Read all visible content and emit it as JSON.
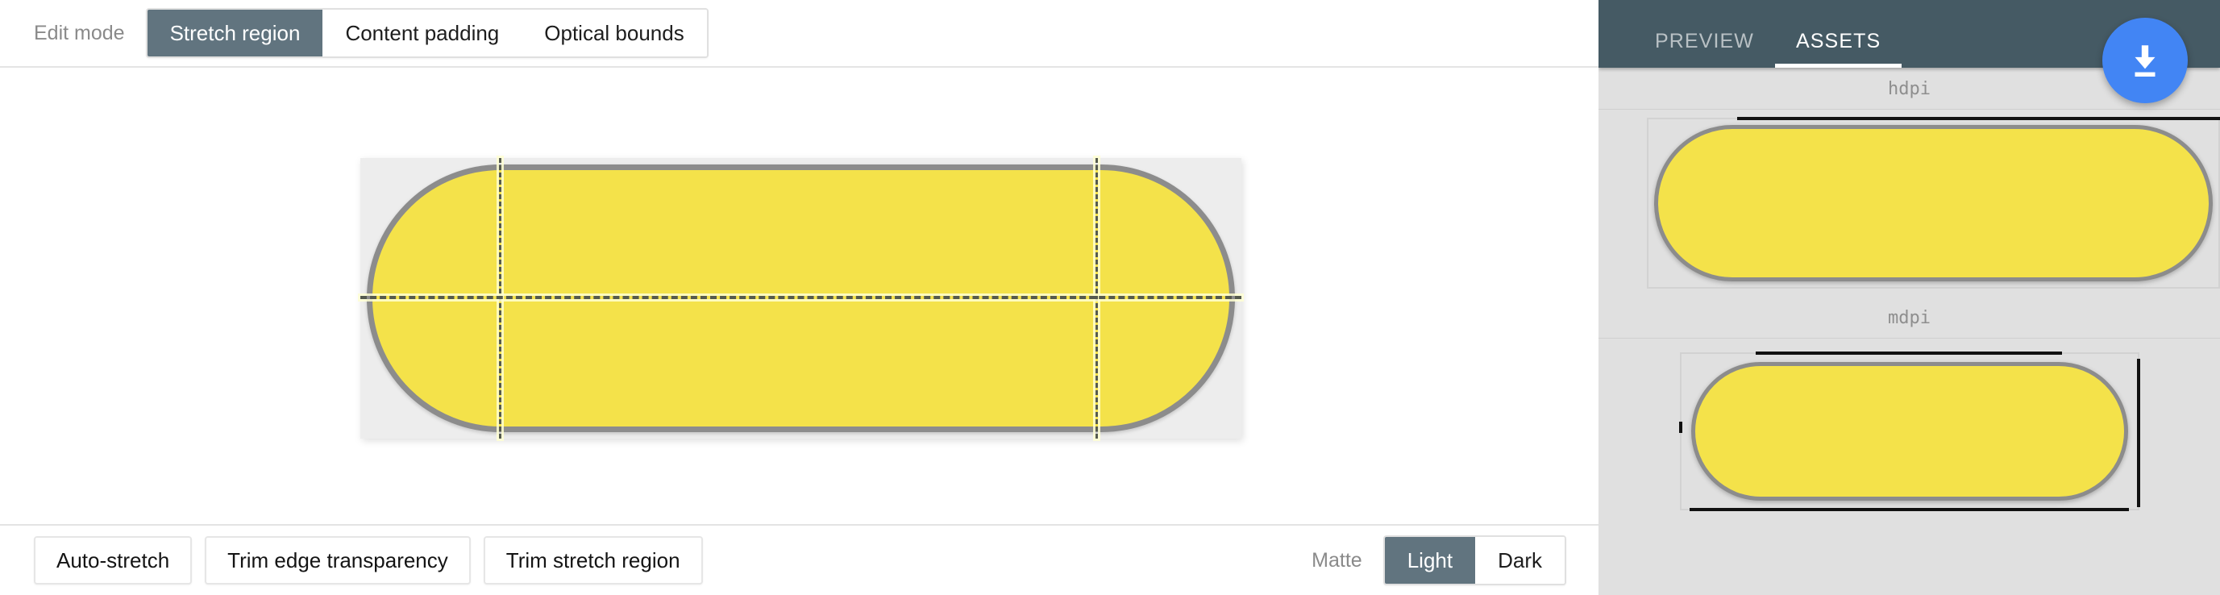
{
  "editor": {
    "top_toolbar": {
      "label": "Edit mode",
      "modes": [
        {
          "label": "Stretch region",
          "active": true
        },
        {
          "label": "Content padding",
          "active": false
        },
        {
          "label": "Optical bounds",
          "active": false
        }
      ]
    },
    "canvas": {
      "shape_fill": "#F4E24A",
      "shape_stroke": "#8C8C8C",
      "card_background": "#EDEDED",
      "guide_color": "#555A4E",
      "guides": [
        "stretch-left",
        "stretch-right",
        "stretch-horizontal"
      ]
    },
    "bottom_toolbar": {
      "actions": [
        {
          "label": "Auto-stretch"
        },
        {
          "label": "Trim edge transparency"
        },
        {
          "label": "Trim stretch region"
        }
      ],
      "matte_label": "Matte",
      "matte_options": [
        {
          "label": "Light",
          "active": true
        },
        {
          "label": "Dark",
          "active": false
        }
      ]
    }
  },
  "assets_pane": {
    "header_color": "#455A64",
    "accent_color": "#4285F4",
    "tabs": [
      {
        "label": "PREVIEW",
        "active": false
      },
      {
        "label": "ASSETS",
        "active": true
      }
    ],
    "download_button": {
      "icon": "download-icon"
    },
    "densities": [
      {
        "label": "hdpi"
      },
      {
        "label": "mdpi"
      }
    ]
  }
}
